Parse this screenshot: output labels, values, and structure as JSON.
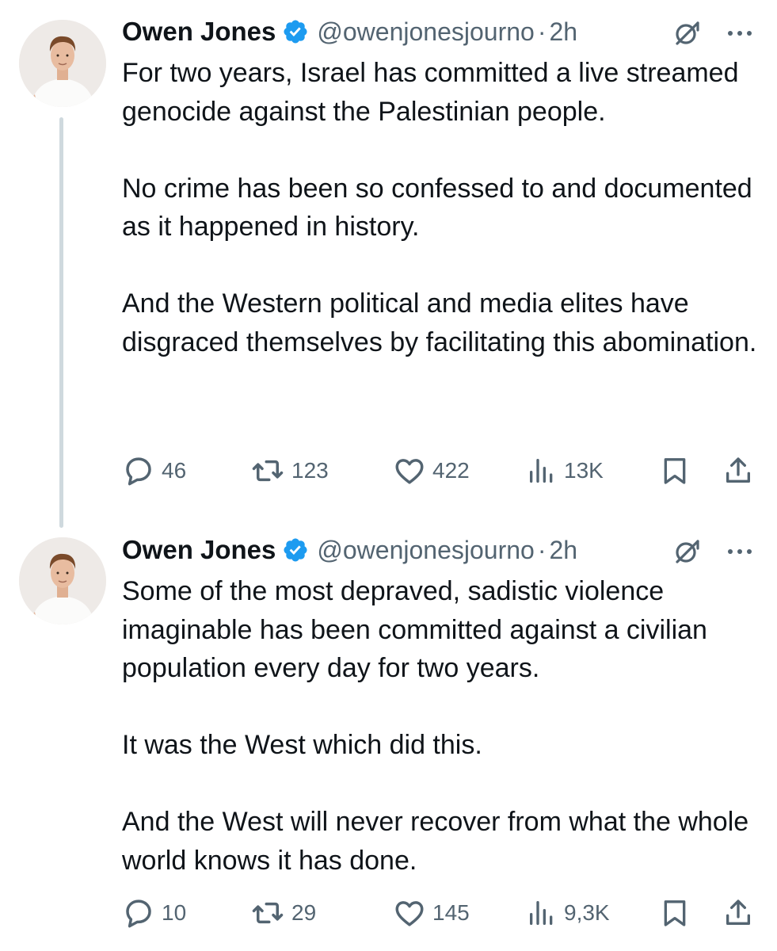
{
  "tweets": [
    {
      "author": "Owen Jones",
      "handle": "@owenjonesjourno",
      "separator": "·",
      "time": "2h",
      "paragraphs": [
        "For two years, Israel has committed a live streamed genocide against the Palestinian people.",
        "No crime has been so confessed to and documented as it happened in history.",
        "And the Western political and media elites have disgraced themselves by facilitating this abomination."
      ],
      "stats": {
        "replies": "46",
        "reposts": "123",
        "likes": "422",
        "views": "13K"
      }
    },
    {
      "author": "Owen Jones",
      "handle": "@owenjonesjourno",
      "separator": "·",
      "time": "2h",
      "paragraphs": [
        "Some of the most depraved, sadistic violence imaginable has been committed against a civilian population every day for two years.",
        "It was the West which did this.",
        "And the West will never recover from what the whole world knows it has done."
      ],
      "stats": {
        "replies": "10",
        "reposts": "29",
        "likes": "145",
        "views": "9,3K"
      }
    }
  ],
  "icons": {
    "avatar": "avatar-photo",
    "verified": "verified-badge-icon",
    "grok": "grok-icon",
    "more": "more-icon",
    "reply": "reply-icon",
    "repost": "repost-icon",
    "like": "heart-icon",
    "views": "views-icon",
    "bookmark": "bookmark-icon",
    "share": "share-icon"
  },
  "colors": {
    "text": "#0f1419",
    "secondary": "#536471",
    "verified": "#1d9bf0",
    "thread_line": "#cfd9de"
  }
}
